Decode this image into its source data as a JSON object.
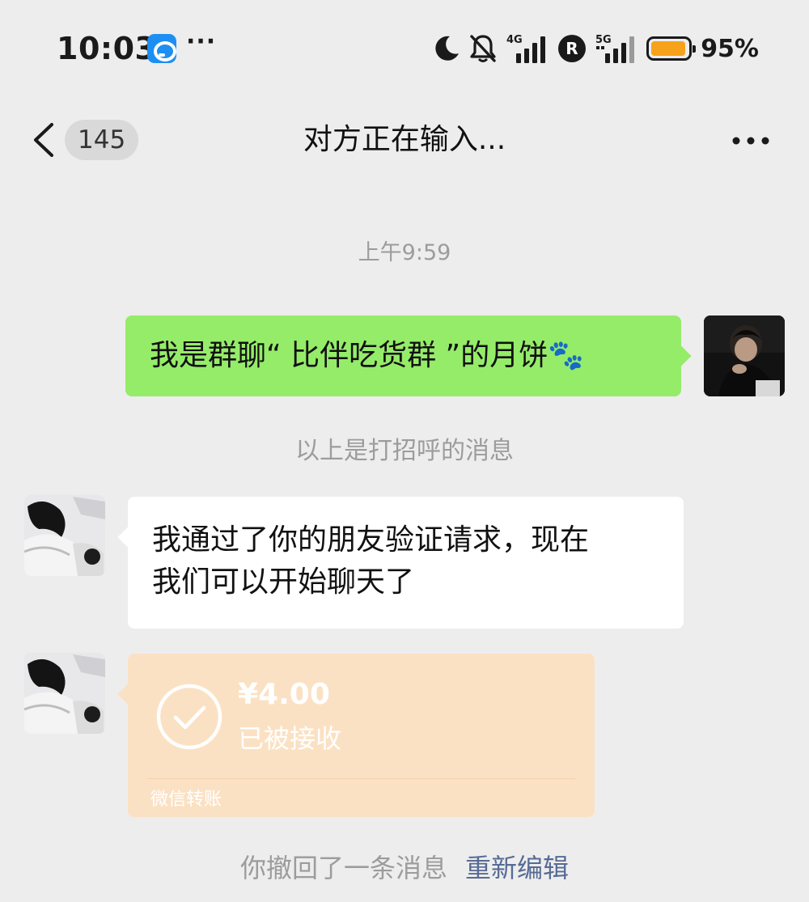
{
  "status_bar": {
    "time": "10:03",
    "app_icon": "blue-app-notification-icon",
    "more": "···",
    "icons": [
      "moon-icon",
      "bell-muted-icon",
      "signal-4g-icon",
      "r-badge-icon",
      "signal-5g-icon",
      "battery-icon"
    ],
    "signal_4g_label": "4G",
    "signal_5g_label": "5G",
    "r_badge": "R",
    "battery_percent": "95%",
    "battery_level": 0.95,
    "battery_color": "#f7a21b"
  },
  "nav": {
    "back_icon": "chevron-left-icon",
    "unread_count": "145",
    "title": "对方正在输入...",
    "more_icon": "more-dots-icon"
  },
  "chat": {
    "timestamp": "上午9:59",
    "self_message": "我是群聊“ 比伴吃货群 ”的月饼🐾",
    "self_bubble_color": "#95ec69",
    "greeting_note": "以上是打招呼的消息",
    "peer_message_line1": "我通过了你的朋友验证请求，现在",
    "peer_message_line2": "我们可以开始聊天了",
    "transfer": {
      "amount": "¥4.00",
      "status": "已被接收",
      "label": "微信转账",
      "icon": "check-circle-icon",
      "color": "#fbe1c3"
    },
    "recall_text": "你撤回了一条消息",
    "recall_action": "重新编辑",
    "link_color": "#576b95"
  }
}
